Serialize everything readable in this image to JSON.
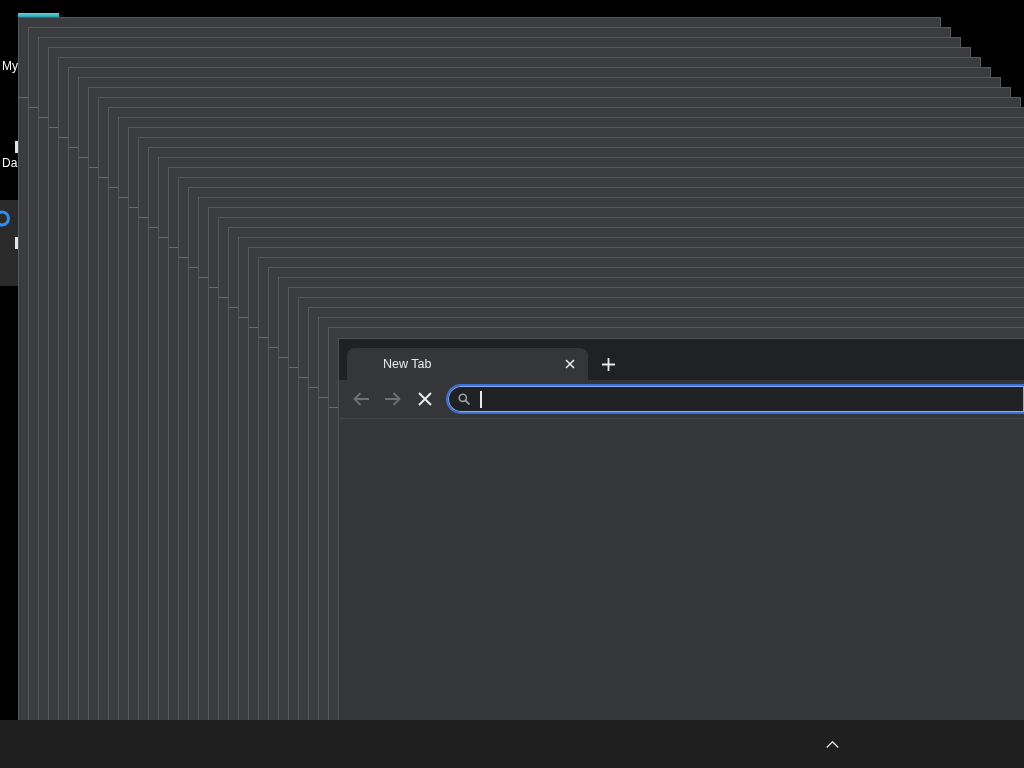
{
  "desktop_icons": [
    {
      "label": "My"
    },
    {
      "label": "Da"
    }
  ],
  "browser": {
    "tabs": [
      {
        "title": "New Tab",
        "selected": true
      }
    ],
    "nav_buttons": [
      {
        "kind": "back",
        "disabled": true
      },
      {
        "kind": "forward",
        "disabled": true
      },
      {
        "kind": "stop",
        "disabled": false
      }
    ],
    "address_bar": {
      "focused": true
    }
  }
}
